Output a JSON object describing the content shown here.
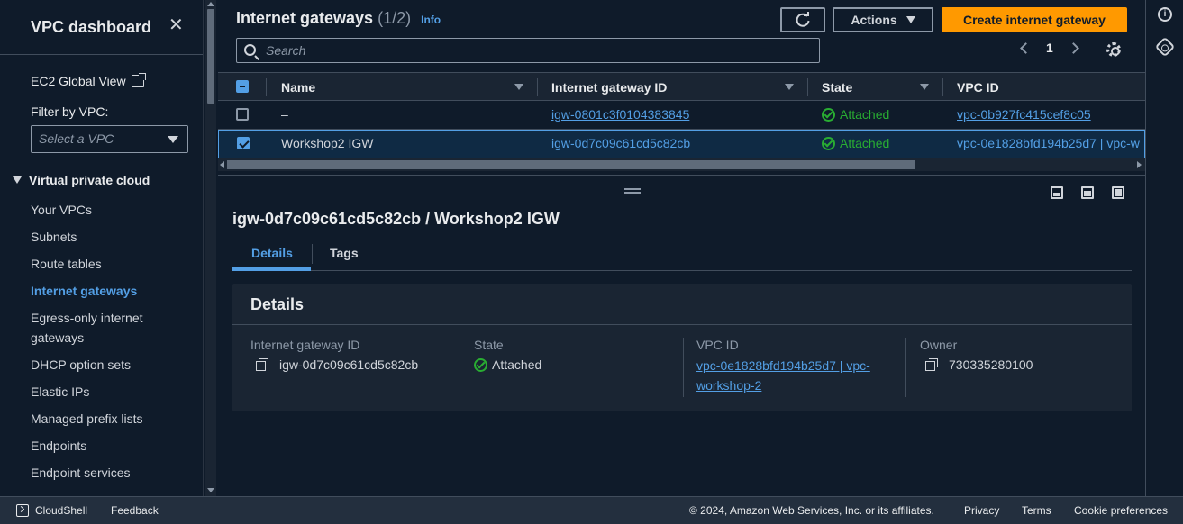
{
  "sidebar": {
    "title": "VPC dashboard",
    "ec2_global_view": "EC2 Global View",
    "filter_label": "Filter by VPC:",
    "filter_placeholder": "Select a VPC",
    "section": "Virtual private cloud",
    "items": [
      {
        "label": "Your VPCs"
      },
      {
        "label": "Subnets"
      },
      {
        "label": "Route tables"
      },
      {
        "label": "Internet gateways",
        "active": true
      },
      {
        "label": "Egress-only internet gateways"
      },
      {
        "label": "DHCP option sets"
      },
      {
        "label": "Elastic IPs"
      },
      {
        "label": "Managed prefix lists"
      },
      {
        "label": "Endpoints"
      },
      {
        "label": "Endpoint services"
      }
    ]
  },
  "header": {
    "title": "Internet gateways",
    "count": "(1/2)",
    "info": "Info",
    "actions_label": "Actions",
    "create_label": "Create internet gateway",
    "search_placeholder": "Search",
    "page": "1"
  },
  "table": {
    "columns": [
      "Name",
      "Internet gateway ID",
      "State",
      "VPC ID"
    ],
    "rows": [
      {
        "name": "–",
        "id": "igw-0801c3f0104383845",
        "state": "Attached",
        "vpc": "vpc-0b927fc415cef8c05",
        "selected": false
      },
      {
        "name": "Workshop2 IGW",
        "id": "igw-0d7c09c61cd5c82cb",
        "state": "Attached",
        "vpc": "vpc-0e1828bfd194b25d7 | vpc-w",
        "selected": true
      }
    ]
  },
  "detail": {
    "title": "igw-0d7c09c61cd5c82cb / Workshop2 IGW",
    "tabs": [
      "Details",
      "Tags"
    ],
    "card_title": "Details",
    "fields": {
      "igw_label": "Internet gateway ID",
      "igw_value": "igw-0d7c09c61cd5c82cb",
      "state_label": "State",
      "state_value": "Attached",
      "vpc_label": "VPC ID",
      "vpc_value_1": "vpc-0e1828bfd194b25d7 | vpc-",
      "vpc_value_2": "workshop-2",
      "owner_label": "Owner",
      "owner_value": "730335280100"
    }
  },
  "footer": {
    "cloudshell": "CloudShell",
    "feedback": "Feedback",
    "copyright": "© 2024, Amazon Web Services, Inc. or its affiliates.",
    "privacy": "Privacy",
    "terms": "Terms",
    "cookies": "Cookie preferences"
  },
  "colors": {
    "accent": "#539fe5",
    "primary_button": "#ff9900",
    "success": "#29ad32",
    "background": "#0f1b2a"
  }
}
